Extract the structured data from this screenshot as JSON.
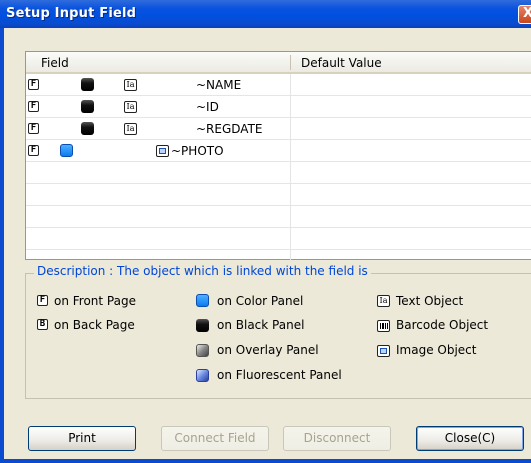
{
  "window": {
    "title": "Setup Input Field",
    "close_glyph": "X"
  },
  "grid": {
    "columns": [
      "Field",
      "Default Value"
    ],
    "rows": [
      {
        "page": "F",
        "panel": "black",
        "object": "text",
        "name": "~NAME",
        "default": ""
      },
      {
        "page": "F",
        "panel": "black",
        "object": "text",
        "name": "~ID",
        "default": ""
      },
      {
        "page": "F",
        "panel": "black",
        "object": "text",
        "name": "~REGDATE",
        "default": ""
      },
      {
        "page": "F",
        "panel": "color",
        "object": "image",
        "name": "~PHOTO",
        "default": ""
      }
    ]
  },
  "description": {
    "legend": "Description : The object which is linked with the field is",
    "items": {
      "front_page": "on Front Page",
      "back_page": "on Back Page",
      "color_panel": "on Color Panel",
      "black_panel": "on Black Panel",
      "overlay_panel": "on Overlay Panel",
      "fluorescent_panel": "on Fluorescent Panel",
      "text_object": "Text Object",
      "barcode_object": "Barcode Object",
      "image_object": "Image Object"
    },
    "front_letter": "F",
    "back_letter": "B",
    "text_glyph": "Ia"
  },
  "buttons": {
    "print": "Print",
    "connect_field": "Connect Field",
    "disconnect": "Disconnect",
    "close": "Close(C)"
  },
  "colors": {
    "titlebar": "#0a53df",
    "legend_text": "#0046d5",
    "color_panel": "#0a7cf0"
  }
}
